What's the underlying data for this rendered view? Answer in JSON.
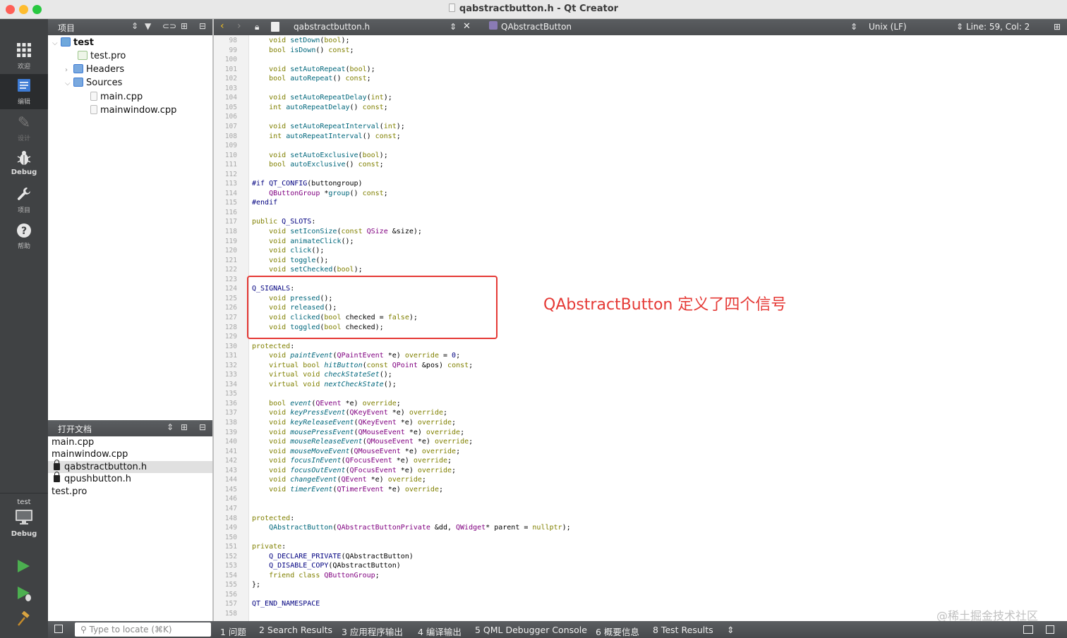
{
  "window": {
    "title": "qabstractbutton.h - Qt Creator"
  },
  "modes": [
    {
      "label": "欢迎",
      "icon": "grid-icon"
    },
    {
      "label": "编辑",
      "icon": "edit-doc-icon"
    },
    {
      "label": "设计",
      "icon": "pen-icon"
    },
    {
      "label": "Debug",
      "icon": "bug-icon"
    },
    {
      "label": "项目",
      "icon": "wrench-icon"
    },
    {
      "label": "帮助",
      "icon": "help-icon"
    }
  ],
  "kit": {
    "project": "test",
    "config": "Debug"
  },
  "project_pane": {
    "title": "项目"
  },
  "tree": [
    {
      "label": "test",
      "level": 0,
      "expanded": true
    },
    {
      "label": "test.pro",
      "level": 1
    },
    {
      "label": "Headers",
      "level": 1,
      "expanded": false
    },
    {
      "label": "Sources",
      "level": 1,
      "expanded": true
    },
    {
      "label": "main.cpp",
      "level": 2
    },
    {
      "label": "mainwindow.cpp",
      "level": 2
    }
  ],
  "open_docs": {
    "title": "打开文档",
    "items": [
      {
        "label": "main.cpp",
        "locked": false,
        "selected": false
      },
      {
        "label": "mainwindow.cpp",
        "locked": false,
        "selected": false
      },
      {
        "label": "qabstractbutton.h",
        "locked": true,
        "selected": true
      },
      {
        "label": "qpushbutton.h",
        "locked": true,
        "selected": false
      },
      {
        "label": "test.pro",
        "locked": false,
        "selected": false
      }
    ]
  },
  "editor": {
    "file": "qabstractbutton.h",
    "symbol": "QAbstractButton",
    "line_ending": "Unix (LF)",
    "position": "Line: 59, Col: 2"
  },
  "code_lines": [
    {
      "n": "98",
      "h": "    <span class=kw>void</span> <span class=fn>setDown</span>(<span class=kw>bool</span>);"
    },
    {
      "n": "99",
      "h": "    <span class=kw>bool</span> <span class=fn>isDown</span>() <span class=kw>const</span>;"
    },
    {
      "n": "100",
      "h": ""
    },
    {
      "n": "101",
      "h": "    <span class=kw>void</span> <span class=fn>setAutoRepeat</span>(<span class=kw>bool</span>);"
    },
    {
      "n": "102",
      "h": "    <span class=kw>bool</span> <span class=fn>autoRepeat</span>() <span class=kw>const</span>;"
    },
    {
      "n": "103",
      "h": ""
    },
    {
      "n": "104",
      "h": "    <span class=kw>void</span> <span class=fn>setAutoRepeatDelay</span>(<span class=kw>int</span>);"
    },
    {
      "n": "105",
      "h": "    <span class=kw>int</span> <span class=fn>autoRepeatDelay</span>() <span class=kw>const</span>;"
    },
    {
      "n": "106",
      "h": ""
    },
    {
      "n": "107",
      "h": "    <span class=kw>void</span> <span class=fn>setAutoRepeatInterval</span>(<span class=kw>int</span>);"
    },
    {
      "n": "108",
      "h": "    <span class=kw>int</span> <span class=fn>autoRepeatInterval</span>() <span class=kw>const</span>;"
    },
    {
      "n": "109",
      "h": ""
    },
    {
      "n": "110",
      "h": "    <span class=kw>void</span> <span class=fn>setAutoExclusive</span>(<span class=kw>bool</span>);"
    },
    {
      "n": "111",
      "h": "    <span class=kw>bool</span> <span class=fn>autoExclusive</span>() <span class=kw>const</span>;"
    },
    {
      "n": "112",
      "h": ""
    },
    {
      "n": "113",
      "h": "<span class=mac>#if</span> <span class=mac>QT_CONFIG</span>(buttongroup)"
    },
    {
      "n": "114",
      "h": "    <span class=ty>QButtonGroup</span> *<span class=fn>group</span>() <span class=kw>const</span>;"
    },
    {
      "n": "115",
      "h": "<span class=mac>#endif</span>"
    },
    {
      "n": "116",
      "h": ""
    },
    {
      "n": "117",
      "h": "<span class=kw>public</span> <span class=mac>Q_SLOTS</span>:"
    },
    {
      "n": "118",
      "h": "    <span class=kw>void</span> <span class=fn>setIconSize</span>(<span class=kw>const</span> <span class=ty>QSize</span> &amp;size);"
    },
    {
      "n": "119",
      "h": "    <span class=kw>void</span> <span class=fn>animateClick</span>();"
    },
    {
      "n": "120",
      "h": "    <span class=kw>void</span> <span class=fn>click</span>();"
    },
    {
      "n": "121",
      "h": "    <span class=kw>void</span> <span class=fn>toggle</span>();"
    },
    {
      "n": "122",
      "h": "    <span class=kw>void</span> <span class=fn>setChecked</span>(<span class=kw>bool</span>);"
    },
    {
      "n": "123",
      "h": ""
    },
    {
      "n": "124",
      "h": "<span class=mac>Q_SIGNALS</span>:"
    },
    {
      "n": "125",
      "h": "    <span class=kw>void</span> <span class=fn>pressed</span>();"
    },
    {
      "n": "126",
      "h": "    <span class=kw>void</span> <span class=fn>released</span>();"
    },
    {
      "n": "127",
      "h": "    <span class=kw>void</span> <span class=fn>clicked</span>(<span class=kw>bool</span> checked = <span class=kw>false</span>);"
    },
    {
      "n": "128",
      "h": "    <span class=kw>void</span> <span class=fn>toggled</span>(<span class=kw>bool</span> checked);"
    },
    {
      "n": "129",
      "h": ""
    },
    {
      "n": "130",
      "h": "<span class=kw>protected</span>:"
    },
    {
      "n": "131",
      "h": "    <span class=kw>void</span> <span class=it>paintEvent</span>(<span class=ty>QPaintEvent</span> *e) <span class=kw>override</span> = <span class=num>0</span>;"
    },
    {
      "n": "132",
      "h": "    <span class=kw>virtual</span> <span class=kw>bool</span> <span class=it>hitButton</span>(<span class=kw>const</span> <span class=ty>QPoint</span> &amp;pos) <span class=kw>const</span>;"
    },
    {
      "n": "133",
      "h": "    <span class=kw>virtual</span> <span class=kw>void</span> <span class=it>checkStateSet</span>();"
    },
    {
      "n": "134",
      "h": "    <span class=kw>virtual</span> <span class=kw>void</span> <span class=it>nextCheckState</span>();"
    },
    {
      "n": "135",
      "h": ""
    },
    {
      "n": "136",
      "h": "    <span class=kw>bool</span> <span class=it>event</span>(<span class=ty>QEvent</span> *e) <span class=kw>override</span>;"
    },
    {
      "n": "137",
      "h": "    <span class=kw>void</span> <span class=it>keyPressEvent</span>(<span class=ty>QKeyEvent</span> *e) <span class=kw>override</span>;"
    },
    {
      "n": "138",
      "h": "    <span class=kw>void</span> <span class=it>keyReleaseEvent</span>(<span class=ty>QKeyEvent</span> *e) <span class=kw>override</span>;"
    },
    {
      "n": "139",
      "h": "    <span class=kw>void</span> <span class=it>mousePressEvent</span>(<span class=ty>QMouseEvent</span> *e) <span class=kw>override</span>;"
    },
    {
      "n": "140",
      "h": "    <span class=kw>void</span> <span class=it>mouseReleaseEvent</span>(<span class=ty>QMouseEvent</span> *e) <span class=kw>override</span>;"
    },
    {
      "n": "141",
      "h": "    <span class=kw>void</span> <span class=it>mouseMoveEvent</span>(<span class=ty>QMouseEvent</span> *e) <span class=kw>override</span>;"
    },
    {
      "n": "142",
      "h": "    <span class=kw>void</span> <span class=it>focusInEvent</span>(<span class=ty>QFocusEvent</span> *e) <span class=kw>override</span>;"
    },
    {
      "n": "143",
      "h": "    <span class=kw>void</span> <span class=it>focusOutEvent</span>(<span class=ty>QFocusEvent</span> *e) <span class=kw>override</span>;"
    },
    {
      "n": "144",
      "h": "    <span class=kw>void</span> <span class=it>changeEvent</span>(<span class=ty>QEvent</span> *e) <span class=kw>override</span>;"
    },
    {
      "n": "145",
      "h": "    <span class=kw>void</span> <span class=it>timerEvent</span>(<span class=ty>QTimerEvent</span> *e) <span class=kw>override</span>;"
    },
    {
      "n": "146",
      "h": ""
    },
    {
      "n": "147",
      "h": ""
    },
    {
      "n": "148",
      "h": "<span class=kw>protected</span>:"
    },
    {
      "n": "149",
      "h": "    <span class=fn>QAbstractButton</span>(<span class=ty>QAbstractButtonPrivate</span> &amp;dd, <span class=ty>QWidget</span>* parent = <span class=kw>nullptr</span>);"
    },
    {
      "n": "150",
      "h": ""
    },
    {
      "n": "151",
      "h": "<span class=kw>private</span>:"
    },
    {
      "n": "152",
      "h": "    <span class=mac>Q_DECLARE_PRIVATE</span>(QAbstractButton)"
    },
    {
      "n": "153",
      "h": "    <span class=mac>Q_DISABLE_COPY</span>(QAbstractButton)"
    },
    {
      "n": "154",
      "h": "    <span class=kw>friend</span> <span class=kw>class</span> <span class=ty>QButtonGroup</span>;"
    },
    {
      "n": "155",
      "h": "};"
    },
    {
      "n": "156",
      "h": ""
    },
    {
      "n": "157",
      "h": "<span class=mac>QT_END_NAMESPACE</span>"
    },
    {
      "n": "158",
      "h": ""
    }
  ],
  "annotation": "QAbstractButton 定义了四个信号",
  "watermark": "@稀土掘金技术社区",
  "locator": {
    "placeholder": "Type to locate (⌘K)"
  },
  "output_tabs": [
    "1 问题",
    "2 Search Results",
    "3 应用程序输出",
    "4 编译输出",
    "5 QML Debugger Console",
    "6 概要信息",
    "8 Test Results"
  ]
}
